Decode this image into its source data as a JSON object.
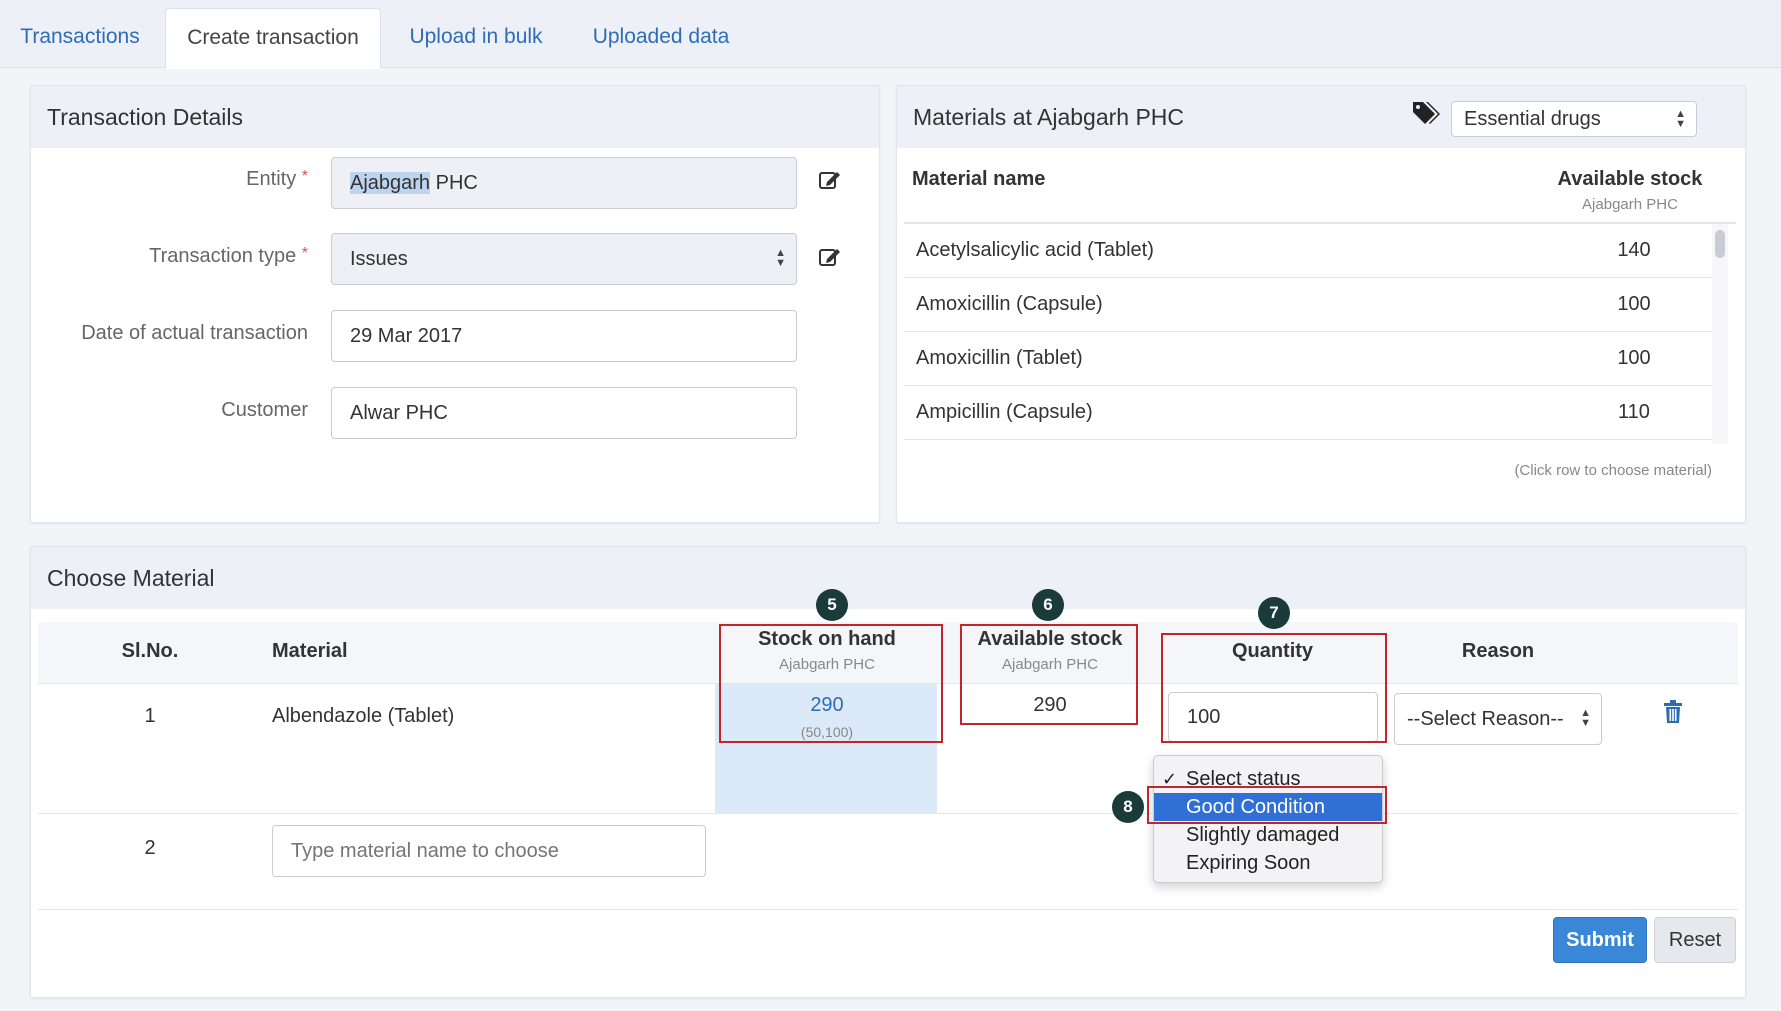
{
  "tabs": [
    {
      "label": "Transactions"
    },
    {
      "label": "Create transaction"
    },
    {
      "label": "Upload in bulk"
    },
    {
      "label": "Uploaded data"
    }
  ],
  "transaction_details": {
    "title": "Transaction Details",
    "entity_label": "Entity",
    "entity_value_highlight": "Ajabgarh",
    "entity_value_rest": " PHC",
    "type_label": "Transaction type",
    "type_value": "Issues",
    "date_label": "Date of actual transaction",
    "date_value": "29 Mar 2017",
    "customer_label": "Customer",
    "customer_value": "Alwar PHC",
    "required_mark": "*"
  },
  "materials": {
    "title": "Materials at Ajabgarh PHC",
    "filter_value": "Essential drugs",
    "col_name": "Material name",
    "col_stock": "Available stock",
    "col_stock_sub": "Ajabgarh PHC",
    "rows": [
      {
        "name": "Acetylsalicylic acid (Tablet)",
        "stock": "140"
      },
      {
        "name": "Amoxicillin (Capsule)",
        "stock": "100"
      },
      {
        "name": "Amoxicillin (Tablet)",
        "stock": "100"
      },
      {
        "name": "Ampicillin (Capsule)",
        "stock": "110"
      }
    ],
    "hint": "(Click row to choose material)"
  },
  "choose_material": {
    "title": "Choose Material",
    "col_slno": "Sl.No.",
    "col_material": "Material",
    "col_soh": "Stock on hand",
    "col_soh_sub": "Ajabgarh PHC",
    "col_avail": "Available stock",
    "col_avail_sub": "Ajabgarh PHC",
    "col_qty": "Quantity",
    "col_reason": "Reason",
    "row1": {
      "slno": "1",
      "material": "Albendazole (Tablet)",
      "soh": "290",
      "soh_range": "(50,100)",
      "avail": "290",
      "qty": "100",
      "reason": "--Select Reason--"
    },
    "row2": {
      "slno": "2",
      "placeholder": "Type material name to choose"
    }
  },
  "status_dropdown": {
    "check": "✓",
    "options": [
      "Select status",
      "Good Condition",
      "Slightly damaged",
      "Expiring Soon"
    ],
    "selected_index": 1
  },
  "badges": {
    "b5": "5",
    "b6": "6",
    "b7": "7",
    "b8": "8"
  },
  "buttons": {
    "submit": "Submit",
    "reset": "Reset"
  },
  "icons": {
    "edit": "edit-icon",
    "tags": "tags-icon",
    "trash": "trash-icon"
  },
  "colors": {
    "accent": "#3a87d8",
    "annotation": "#c0272d",
    "highlight": "#dbe9f8"
  }
}
